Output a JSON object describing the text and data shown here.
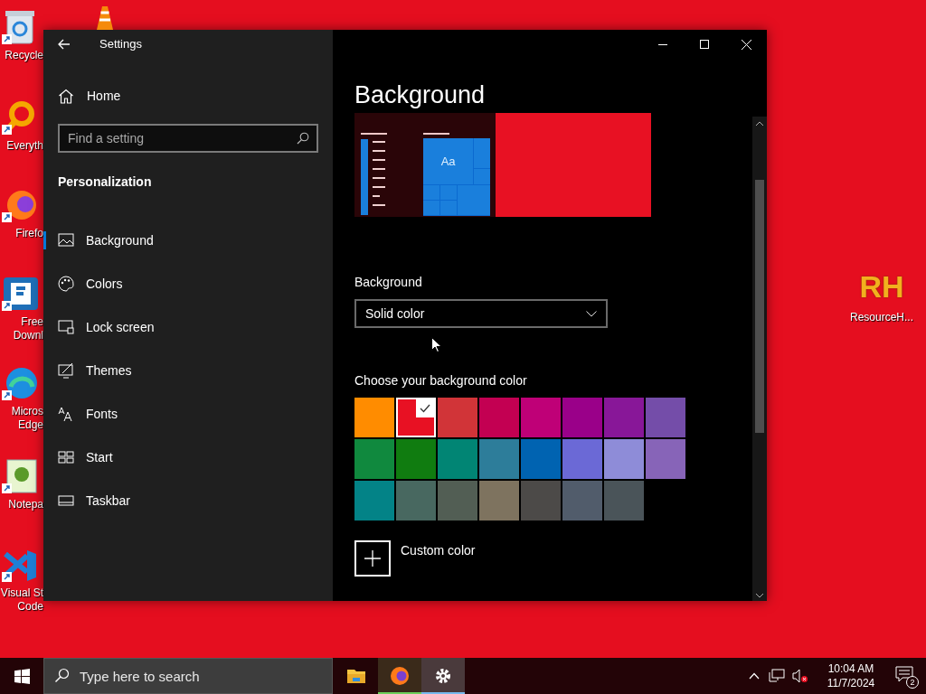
{
  "desktop_icons": [
    {
      "kind": "recycle",
      "lines": [
        "Recycle"
      ]
    },
    {
      "kind": "search",
      "lines": [
        "Everyth"
      ]
    },
    {
      "kind": "firefox",
      "lines": [
        "Firefo"
      ]
    },
    {
      "kind": "download",
      "lines": [
        "Free",
        "Downl"
      ]
    },
    {
      "kind": "edge",
      "lines": [
        "Micros",
        "Edge"
      ]
    },
    {
      "kind": "notepad",
      "lines": [
        "Notepa"
      ]
    },
    {
      "kind": "vscode",
      "lines": [
        "Visual St",
        "Code"
      ]
    }
  ],
  "desktop_right_icon": {
    "logo": "RH",
    "label": "ResourceH..."
  },
  "window": {
    "title": "Settings"
  },
  "sidebar": {
    "home": "Home",
    "search": {
      "placeholder": "Find a setting"
    },
    "section": "Personalization",
    "items": [
      {
        "kind": "picture",
        "label": "Background",
        "selected": true
      },
      {
        "kind": "palette",
        "label": "Colors",
        "selected": false
      },
      {
        "kind": "lock",
        "label": "Lock screen",
        "selected": false
      },
      {
        "kind": "themes",
        "label": "Themes",
        "selected": false
      },
      {
        "kind": "fonts",
        "label": "Fonts",
        "selected": false
      },
      {
        "kind": "start",
        "label": "Start",
        "selected": false
      },
      {
        "kind": "taskbar",
        "label": "Taskbar",
        "selected": false
      }
    ]
  },
  "page": {
    "title": "Background",
    "preview": {
      "tile_text": "Aa",
      "color": "#e81123"
    },
    "background_label": "Background",
    "background_value": "Solid color",
    "colors_label": "Choose your background color",
    "colors": [
      {
        "color": "#ff8c00",
        "selected": false
      },
      {
        "color": "#e81123",
        "selected": true
      },
      {
        "color": "#d13438",
        "selected": false
      },
      {
        "color": "#c30052",
        "selected": false
      },
      {
        "color": "#bf0077",
        "selected": false
      },
      {
        "color": "#9a0089",
        "selected": false
      },
      {
        "color": "#881798",
        "selected": false
      },
      {
        "color": "#744da9",
        "selected": false
      },
      {
        "color": "#10893e",
        "selected": false
      },
      {
        "color": "#107c10",
        "selected": false
      },
      {
        "color": "#018574",
        "selected": false
      },
      {
        "color": "#2d7d9a",
        "selected": false
      },
      {
        "color": "#0063b1",
        "selected": false
      },
      {
        "color": "#6b69d6",
        "selected": false
      },
      {
        "color": "#8e8cd8",
        "selected": false
      },
      {
        "color": "#8764b8",
        "selected": false
      },
      {
        "color": "#038387",
        "selected": false
      },
      {
        "color": "#486860",
        "selected": false
      },
      {
        "color": "#525e54",
        "selected": false
      },
      {
        "color": "#7e735f",
        "selected": false
      },
      {
        "color": "#4c4a48",
        "selected": false
      },
      {
        "color": "#515c6b",
        "selected": false
      },
      {
        "color": "#4a5459",
        "selected": false
      }
    ],
    "custom_color": "Custom color"
  },
  "taskbar": {
    "search_placeholder": "Type here to search",
    "apps": [
      {
        "kind": "explorer",
        "active": false,
        "running": false
      },
      {
        "kind": "firefox",
        "active": false,
        "running": true
      },
      {
        "kind": "settings",
        "active": true,
        "running": true
      }
    ],
    "time": "10:04 AM",
    "date": "11/7/2024",
    "notifications": "2"
  }
}
